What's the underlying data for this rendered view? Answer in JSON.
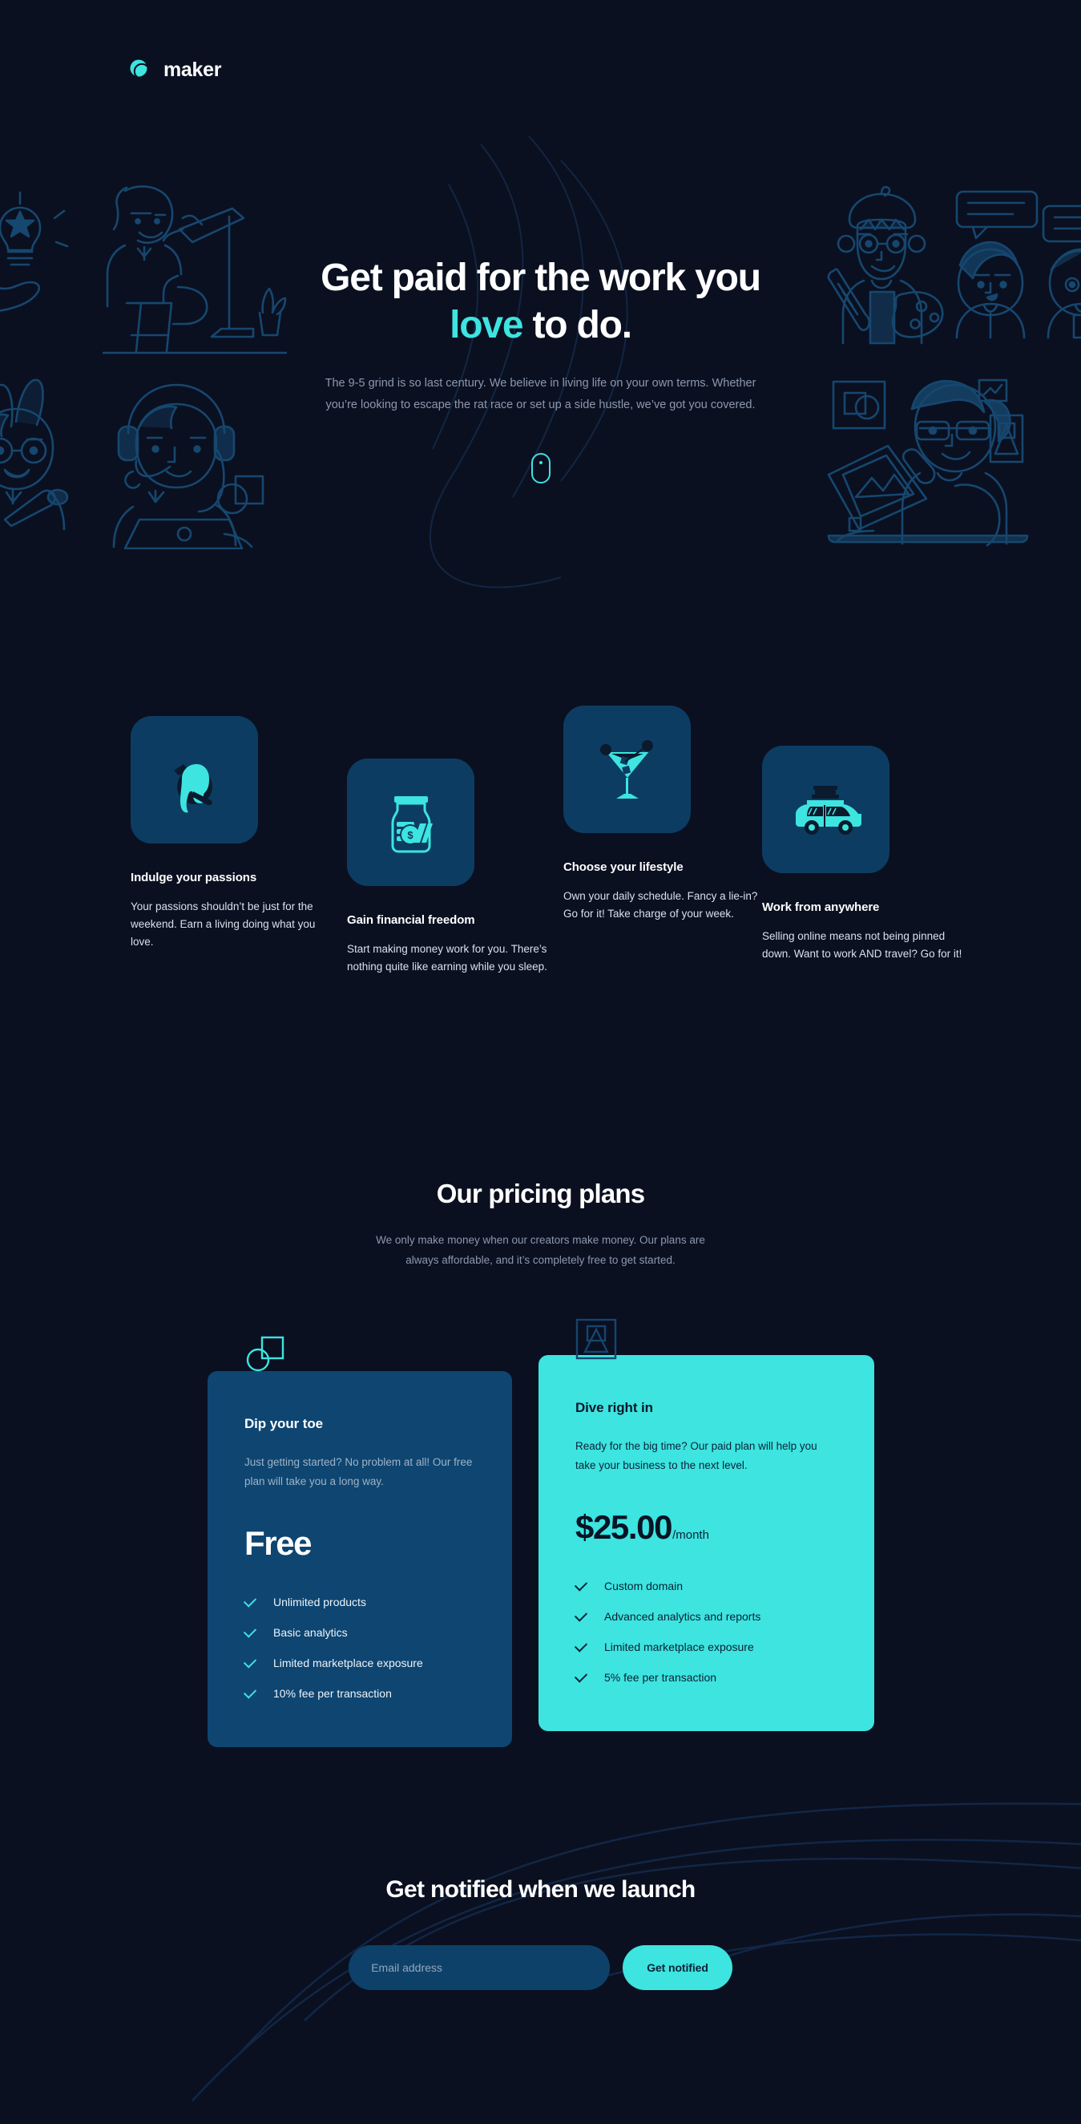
{
  "theme": {
    "bg": "#0a1020",
    "accent_teal": "#3de4e0",
    "card_blue": "#0e4571",
    "tile_blue": "#0d3c63",
    "muted_text": "#8d98ae",
    "illustration_stroke": "#16476f"
  },
  "header": {
    "logo_text": "maker",
    "logo_icon": "maker-circle-logo-icon"
  },
  "hero": {
    "title_part1": "Get paid for the work you ",
    "title_accent": "love",
    "title_part2": " to do.",
    "subtitle": "The 9-5 grind is so last century. We believe in living life on your own terms. Whether you’re looking to escape the rat race or set up a side hustle, we’ve got you covered.",
    "scroll_icon": "scroll-mouse-icon"
  },
  "features": [
    {
      "icon": "cat-paint-icon",
      "title": "Indulge your passions",
      "desc": "Your passions shouldn’t be just for the weekend. Earn a living doing what you love."
    },
    {
      "icon": "money-jar-icon",
      "title": "Gain financial freedom",
      "desc": "Start making money work for you. There’s nothing quite like earning while you sleep."
    },
    {
      "icon": "cocktail-glass-icon",
      "title": "Choose your lifestyle",
      "desc": "Own your daily schedule. Fancy a lie-in? Go for it! Take charge of your week."
    },
    {
      "icon": "car-luggage-icon",
      "title": "Work from anywhere",
      "desc": "Selling online means not being pinned down. Want to work AND travel? Go for it!"
    }
  ],
  "pricing": {
    "heading": "Our pricing plans",
    "subheading": "We only make money when our creators make money. Our plans are always affordable, and it’s completely free to get started.",
    "plans": [
      {
        "badge_icon": "circle-square-badge-icon",
        "name": "Dip your toe",
        "blurb": "Just getting started? No problem at all! Our free plan will take you a long way.",
        "price": "Free",
        "price_period": "",
        "features": [
          "Unlimited products",
          "Basic analytics",
          "Limited marketplace exposure",
          "10% fee per transaction"
        ]
      },
      {
        "badge_icon": "square-triangle-badge-icon",
        "name": "Dive right in",
        "blurb": "Ready for the big time? Our paid plan will help you take your business to the next level.",
        "price": "$25.00",
        "price_period": "/month",
        "features": [
          "Custom domain",
          "Advanced analytics and reports",
          "Limited marketplace exposure",
          "5% fee per transaction"
        ]
      }
    ]
  },
  "newsletter": {
    "heading": "Get notified when we launch",
    "email_placeholder": "Email address",
    "email_value": "",
    "submit_label": "Get notified"
  }
}
